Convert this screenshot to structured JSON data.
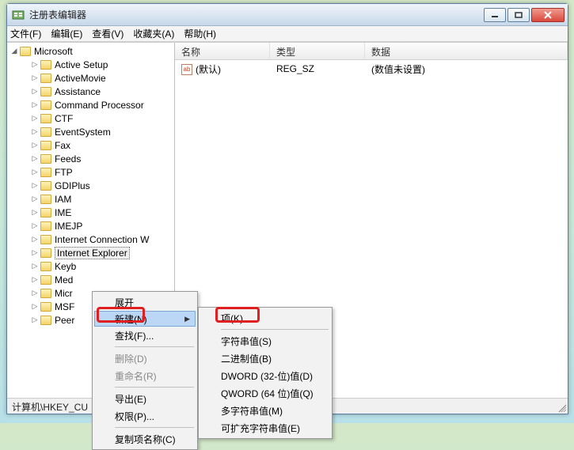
{
  "window": {
    "title": "注册表编辑器"
  },
  "menubar": {
    "file": "文件(F)",
    "edit": "编辑(E)",
    "view": "查看(V)",
    "favorites": "收藏夹(A)",
    "help": "帮助(H)"
  },
  "tree": {
    "root": "Microsoft",
    "items": [
      "Active Setup",
      "ActiveMovie",
      "Assistance",
      "Command Processor",
      "CTF",
      "EventSystem",
      "Fax",
      "Feeds",
      "FTP",
      "GDIPlus",
      "IAM",
      "IME",
      "IMEJP",
      "Internet Connection W",
      "Internet Explorer",
      "Keyb",
      "Med",
      "Micr",
      "MSF",
      "Peer"
    ],
    "selected_index": 14
  },
  "listview": {
    "columns": {
      "name": "名称",
      "type": "类型",
      "data": "数据"
    },
    "rows": [
      {
        "icon": "ab",
        "name": "(默认)",
        "type": "REG_SZ",
        "data": "(数值未设置)"
      }
    ]
  },
  "statusbar": "计算机\\HKEY_CU",
  "context_menu_main": {
    "expand": "展开",
    "new": "新建(N)",
    "find": "查找(F)...",
    "delete": "删除(D)",
    "rename": "重命名(R)",
    "export": "导出(E)",
    "permissions": "权限(P)...",
    "copy_key_name": "复制项名称(C)"
  },
  "context_menu_new": {
    "key": "项(K)",
    "string": "字符串值(S)",
    "binary": "二进制值(B)",
    "dword": "DWORD (32-位)值(D)",
    "qword": "QWORD (64 位)值(Q)",
    "multi_string": "多字符串值(M)",
    "expandable_string": "可扩充字符串值(E)"
  }
}
